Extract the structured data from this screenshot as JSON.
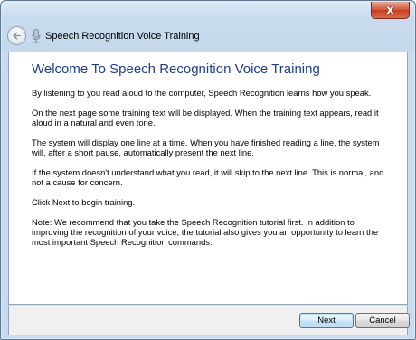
{
  "window": {
    "title": "Speech Recognition Voice Training",
    "close_glyph": "x"
  },
  "icons": {
    "back": "back-arrow-icon",
    "app": "microphone-icon",
    "close": "close-icon"
  },
  "content": {
    "heading": "Welcome To Speech Recognition Voice Training",
    "paragraphs": [
      "By listening to you read aloud to the computer, Speech Recognition learns how you speak.",
      "On the next page some training text will be displayed. When the training text appears, read it aloud in a natural and even tone.",
      "The system will display one line at a time. When you have finished reading a line, the system will, after a short pause, automatically present the next line.",
      "If the system doesn't understand what you read, it will skip to the next line. This is normal, and not a cause for concern.",
      "Click Next to begin training.",
      "Note: We recommend that you take the Speech Recognition tutorial first. In addition to improving the recognition of your voice, the tutorial also gives you an opportunity to learn the most important Speech Recognition commands."
    ]
  },
  "footer": {
    "next_label": "Next",
    "cancel_label": "Cancel"
  },
  "colors": {
    "heading": "#1e3d8f",
    "close_button": "#c73d1f",
    "frame": "#c9dcef"
  }
}
